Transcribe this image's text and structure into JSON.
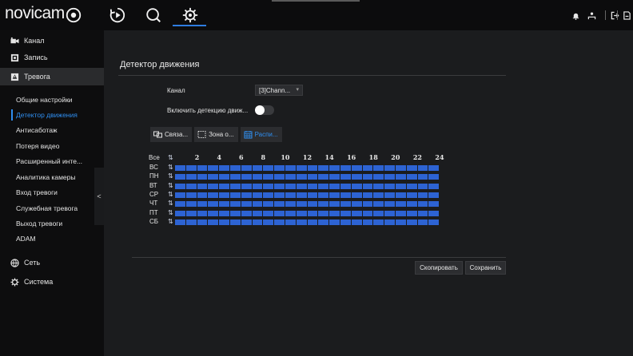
{
  "header": {
    "logo": "novicam",
    "nav": [
      "live-view",
      "playback",
      "search",
      "settings"
    ],
    "active_nav": "settings"
  },
  "sidebar": {
    "sections": [
      {
        "icon": "camera-icon",
        "label": "Канал"
      },
      {
        "icon": "record-icon",
        "label": "Запись"
      },
      {
        "icon": "alarm-icon",
        "label": "Тревога",
        "selected": true
      },
      {
        "icon": "network-icon",
        "label": "Сеть"
      },
      {
        "icon": "system-gear-icon",
        "label": "Система"
      }
    ],
    "alarm_items": [
      "Общие настройки",
      "Детектор движения",
      "Антисаботаж",
      "Потеря видео",
      "Расширенный инте...",
      "Аналитика камеры",
      "Вход тревоги",
      "Служебная тревога",
      "Выход тревоги",
      "ADAM"
    ],
    "active_item": "Детектор движения",
    "collapse_glyph": "<"
  },
  "main": {
    "title": "Детектор движения",
    "channel_label": "Канал",
    "channel_value": "[3]Chann...",
    "enable_label": "Включить детекцию движ...",
    "enable_on": true,
    "tabs": [
      {
        "label": "Связа...",
        "icon": "link-icon"
      },
      {
        "label": "Зона о...",
        "icon": "area-icon"
      },
      {
        "label": "Распи...",
        "icon": "calendar-icon",
        "active": true
      }
    ],
    "schedule": {
      "all_label": "Все",
      "hours": [
        "2",
        "4",
        "6",
        "8",
        "10",
        "12",
        "14",
        "16",
        "18",
        "20",
        "22",
        "24"
      ],
      "days": [
        "ВС",
        "ПН",
        "ВТ",
        "СР",
        "ЧТ",
        "ПТ",
        "СБ"
      ],
      "coverage": 1.0,
      "color": "#2d63d3"
    },
    "buttons": {
      "copy": "Скопировать",
      "save": "Сохранить"
    }
  },
  "colors": {
    "accent": "#2f8ef0",
    "schedule_fill": "#2d63d3",
    "background": "#1b1c1e",
    "sidebar": "#0d0d0e"
  }
}
